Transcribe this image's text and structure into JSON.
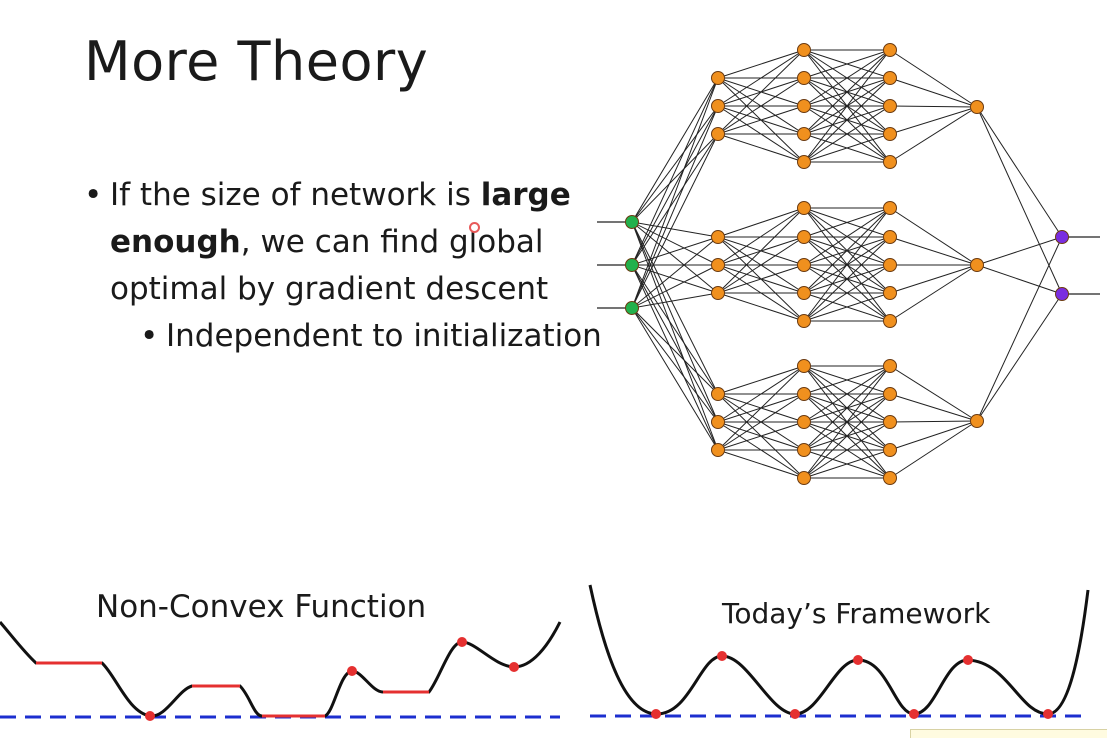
{
  "slide": {
    "title": "More Theory",
    "bullet1": {
      "pre": "If the size of network is ",
      "bold": "large enough",
      "post": ", we can find global optimal by gradient descent"
    },
    "bullet2": "Independent to initialization"
  },
  "diagram": {
    "network": {
      "input_color": "#22b14c",
      "hidden_color": "#f0901e",
      "output_color": "#7a2ee0",
      "input_nodes": 3,
      "output_nodes": 2,
      "groups": [
        {
          "first_layer": 3,
          "second_layer": 5,
          "third_layer": 5,
          "merge": 1
        },
        {
          "first_layer": 3,
          "second_layer": 5,
          "third_layer": 5,
          "merge": 1
        },
        {
          "first_layer": 3,
          "second_layer": 5,
          "third_layer": 5,
          "merge": 1
        }
      ]
    },
    "non_convex": {
      "label": "Non-Convex Function",
      "curve_color": "#111111",
      "highlight_color": "#e53030",
      "baseline_color": "#1c2fcf"
    },
    "framework": {
      "label": "Today’s Framework",
      "curve_color": "#111111",
      "point_color": "#e53030",
      "baseline_color": "#1c2fcf"
    }
  }
}
